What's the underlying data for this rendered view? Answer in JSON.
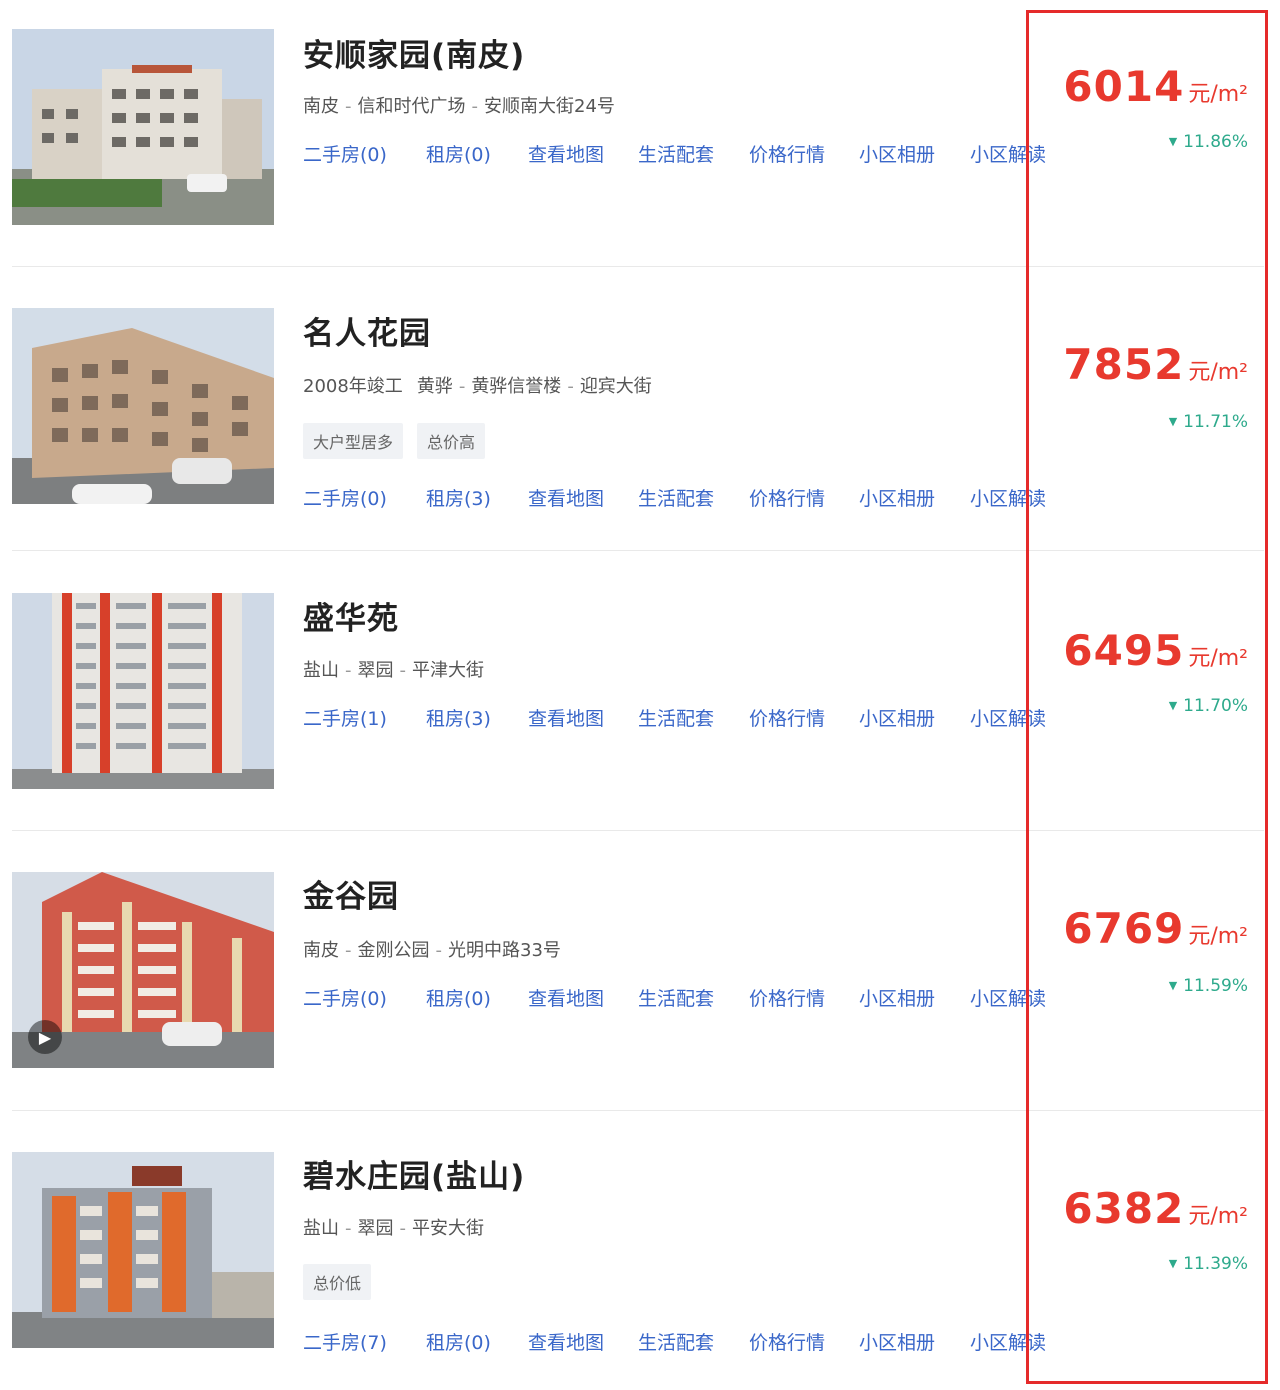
{
  "listings": [
    {
      "name": "安顺家园(南皮)",
      "location": [
        "南皮",
        "信和时代广场",
        "安顺南大街24号"
      ],
      "year": "",
      "tags": [],
      "links": [
        "二手房(0)",
        "租房(0)",
        "查看地图",
        "生活配套",
        "价格行情",
        "小区相册",
        "小区解读"
      ],
      "price": "6014",
      "unit": "元/m²",
      "change": "11.86%"
    },
    {
      "name": "名人花园",
      "location": [
        "黄骅",
        "黄骅信誉楼",
        "迎宾大街"
      ],
      "year": "2008年竣工",
      "tags": [
        "大户型居多",
        "总价高"
      ],
      "links": [
        "二手房(0)",
        "租房(3)",
        "查看地图",
        "生活配套",
        "价格行情",
        "小区相册",
        "小区解读"
      ],
      "price": "7852",
      "unit": "元/m²",
      "change": "11.71%"
    },
    {
      "name": "盛华苑",
      "location": [
        "盐山",
        "翠园",
        "平津大街"
      ],
      "year": "",
      "tags": [],
      "links": [
        "二手房(1)",
        "租房(3)",
        "查看地图",
        "生活配套",
        "价格行情",
        "小区相册",
        "小区解读"
      ],
      "price": "6495",
      "unit": "元/m²",
      "change": "11.70%"
    },
    {
      "name": "金谷园",
      "location": [
        "南皮",
        "金刚公园",
        "光明中路33号"
      ],
      "year": "",
      "tags": [],
      "links": [
        "二手房(0)",
        "租房(0)",
        "查看地图",
        "生活配套",
        "价格行情",
        "小区相册",
        "小区解读"
      ],
      "price": "6769",
      "unit": "元/m²",
      "change": "11.59%"
    },
    {
      "name": "碧水庄园(盐山)",
      "location": [
        "盐山",
        "翠园",
        "平安大街"
      ],
      "year": "",
      "tags": [
        "总价低"
      ],
      "links": [
        "二手房(7)",
        "租房(0)",
        "查看地图",
        "生活配套",
        "价格行情",
        "小区相册",
        "小区解读"
      ],
      "price": "6382",
      "unit": "元/m²",
      "change": "11.39%"
    }
  ],
  "colors": {
    "price": "#e8392e",
    "link": "#3a67c9",
    "change": "#2eaa8c",
    "highlight": "#e52a2a"
  },
  "icons": {
    "change_direction": "triangle-down-icon",
    "video": "play-icon"
  }
}
